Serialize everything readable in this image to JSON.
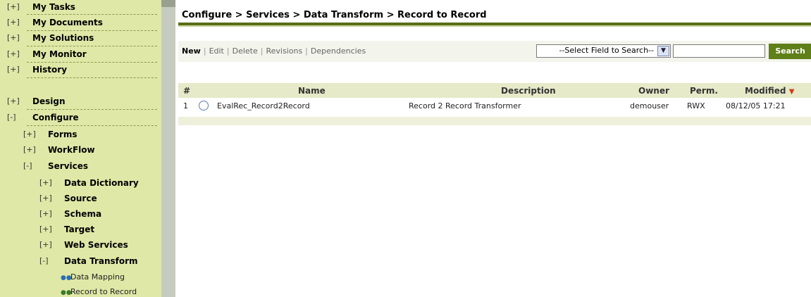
{
  "sidebar": {
    "top_items": [
      {
        "toggle": "[+]",
        "label": "My Tasks"
      },
      {
        "toggle": "[+]",
        "label": "My Documents"
      },
      {
        "toggle": "[+]",
        "label": "My Solutions"
      },
      {
        "toggle": "[+]",
        "label": "My Monitor"
      },
      {
        "toggle": "[+]",
        "label": "History"
      }
    ],
    "design": {
      "toggle": "[+]",
      "label": "Design"
    },
    "configure": {
      "toggle": "[-]",
      "label": "Configure"
    },
    "forms": {
      "toggle": "[+]",
      "label": "Forms"
    },
    "workflow": {
      "toggle": "[+]",
      "label": "WorkFlow"
    },
    "services": {
      "toggle": "[-]",
      "label": "Services"
    },
    "service_items": [
      {
        "toggle": "[+]",
        "label": "Data Dictionary"
      },
      {
        "toggle": "[+]",
        "label": "Source"
      },
      {
        "toggle": "[+]",
        "label": "Schema"
      },
      {
        "toggle": "[+]",
        "label": "Target"
      },
      {
        "toggle": "[+]",
        "label": "Web Services"
      },
      {
        "toggle": "[-]",
        "label": "Data Transform"
      }
    ],
    "leaves": [
      {
        "icon": "data-mapping-icon",
        "label": "Data Mapping"
      },
      {
        "icon": "record-to-record-icon",
        "label": "Record to Record"
      }
    ]
  },
  "breadcrumb": "Configure > Services > Data Transform > Record to Record",
  "actions": {
    "new": "New",
    "edit": "Edit",
    "delete": "Delete",
    "revisions": "Revisions",
    "dependencies": "Dependencies",
    "separator": "|"
  },
  "search": {
    "field_select": "--Select Field to Search--",
    "query": "",
    "button": "Search"
  },
  "table": {
    "columns": [
      "#",
      "Name",
      "Description",
      "Owner",
      "Perm.",
      "Modified"
    ],
    "sorted_column": "Modified",
    "sort_indicator": "▼",
    "rows": [
      {
        "num": "1",
        "name": "EvalRec_Record2Record",
        "description": "Record 2 Record Transformer",
        "owner": "demouser",
        "perm": "RWX",
        "modified": "08/12/05 17:21"
      }
    ]
  },
  "colors": {
    "sidebar_bg": "#dfe8a6",
    "accent": "#5f7f18",
    "sort_arrow": "#d43a1a"
  }
}
